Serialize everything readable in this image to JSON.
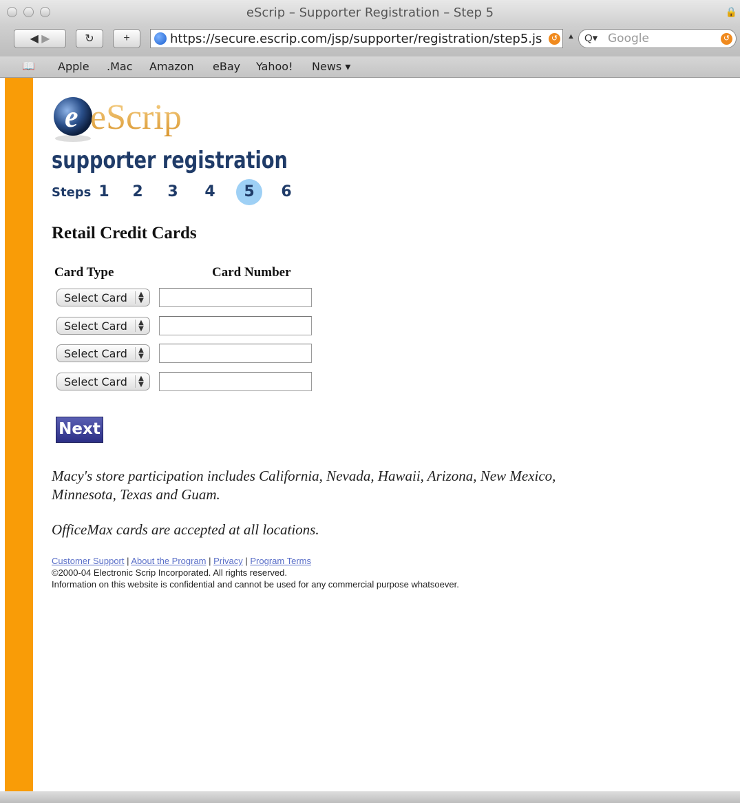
{
  "browser": {
    "window_title": "eScrip – Supporter Registration – Step 5",
    "url": "https://secure.escrip.com/jsp/supporter/registration/step5.js",
    "search_placeholder": "Google",
    "bookmarks": [
      "Apple",
      ".Mac",
      "Amazon",
      "eBay",
      "Yahoo!",
      "News ▾"
    ]
  },
  "page": {
    "logo_text": "eScrip",
    "heading": "supporter registration",
    "steps_label": "Steps",
    "steps": [
      "1",
      "2",
      "3",
      "4",
      "5",
      "6"
    ],
    "active_step": "5",
    "section_title": "Retail Credit Cards",
    "col_card_type": "Card Type",
    "col_card_number": "Card Number",
    "card_rows": [
      {
        "select": "Select Card",
        "number": ""
      },
      {
        "select": "Select Card",
        "number": ""
      },
      {
        "select": "Select Card",
        "number": ""
      },
      {
        "select": "Select Card",
        "number": ""
      }
    ],
    "next_label": "Next",
    "note_macys": "Macy's store participation includes California, Nevada, Hawaii, Arizona, New Mexico, Minnesota, Texas and Guam.",
    "note_officemax": "OfficeMax cards are accepted at all locations."
  },
  "footer": {
    "link_support": "Customer Support",
    "link_about": "About the Program",
    "link_privacy": "Privacy",
    "link_terms": "Program Terms",
    "separator": " | ",
    "copyright": "©2000-04 Electronic Scrip Incorporated. All rights reserved.",
    "confidential": "Information on this website is confidential and cannot be used for any commercial purpose whatsoever."
  },
  "colors": {
    "sidebar": "#f99c07",
    "heading": "#1f3b68",
    "active_step": "#9ed0f5",
    "next_button": "#3b3f96"
  }
}
